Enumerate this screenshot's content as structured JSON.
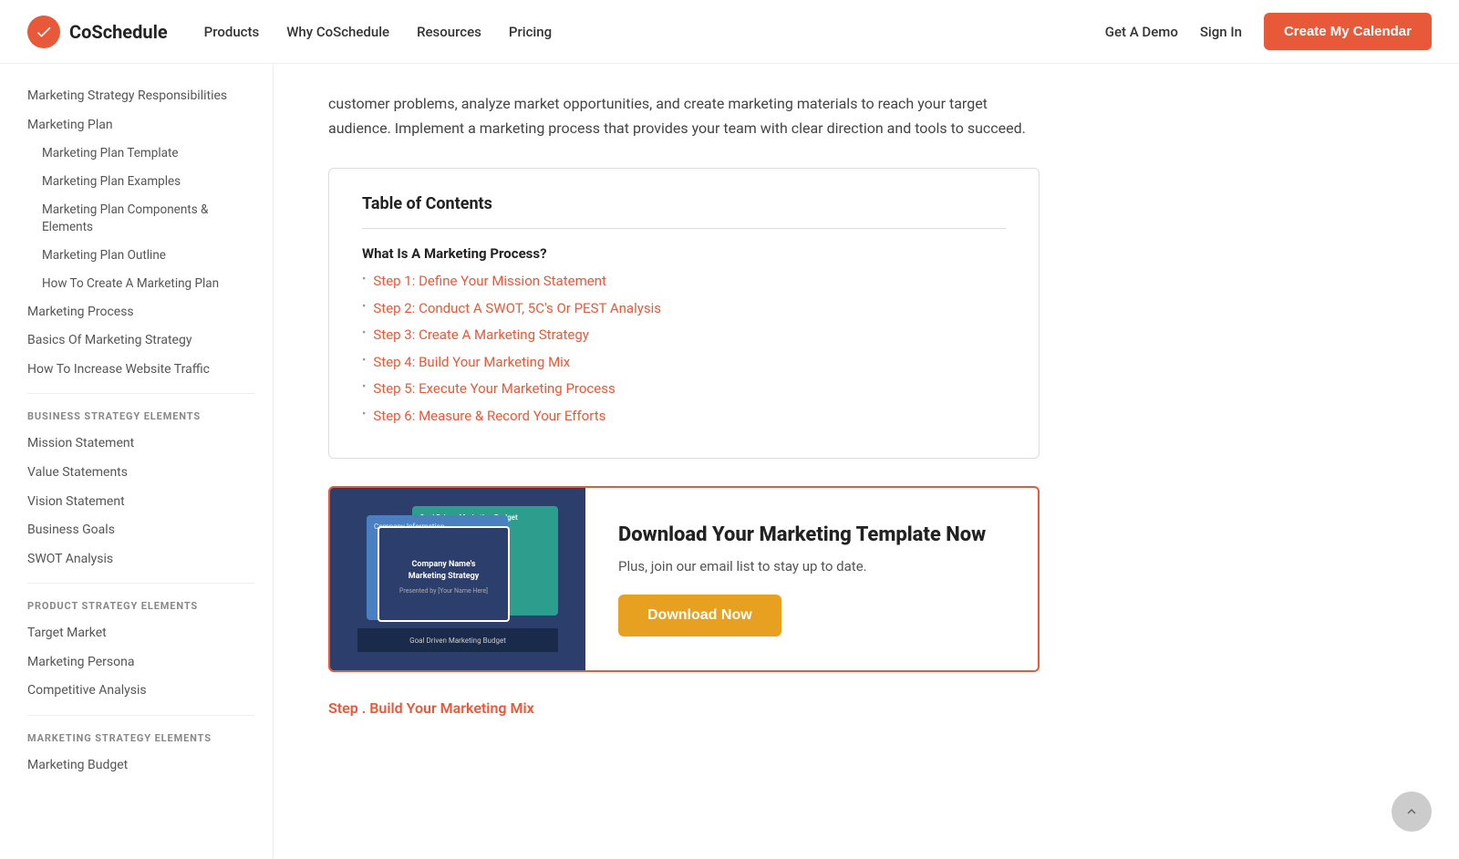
{
  "header": {
    "logo_text": "CoSchedule",
    "nav": [
      {
        "label": "Products",
        "id": "nav-products"
      },
      {
        "label": "Why CoSchedule",
        "id": "nav-why"
      },
      {
        "label": "Resources",
        "id": "nav-resources"
      },
      {
        "label": "Pricing",
        "id": "nav-pricing"
      }
    ],
    "get_demo": "Get A Demo",
    "sign_in": "Sign In",
    "cta_label": "Create My Calendar"
  },
  "sidebar": {
    "top_links": [
      {
        "label": "Marketing Strategy Responsibilities",
        "indent": false
      },
      {
        "label": "Marketing Plan",
        "indent": false
      },
      {
        "label": "Marketing Plan Template",
        "indent": true
      },
      {
        "label": "Marketing Plan Examples",
        "indent": true
      },
      {
        "label": "Marketing Plan Components & Elements",
        "indent": true
      },
      {
        "label": "Marketing Plan Outline",
        "indent": true
      },
      {
        "label": "How To Create A Marketing Plan",
        "indent": true
      },
      {
        "label": "Marketing Process",
        "indent": false
      },
      {
        "label": "Basics Of Marketing Strategy",
        "indent": false
      },
      {
        "label": "How To Increase Website Traffic",
        "indent": false
      }
    ],
    "sections": [
      {
        "title": "BUSINESS STRATEGY ELEMENTS",
        "links": [
          {
            "label": "Mission Statement"
          },
          {
            "label": "Value Statements"
          },
          {
            "label": "Vision Statement"
          },
          {
            "label": "Business Goals"
          },
          {
            "label": "SWOT Analysis"
          }
        ]
      },
      {
        "title": "PRODUCT STRATEGY ELEMENTS",
        "links": [
          {
            "label": "Target Market"
          },
          {
            "label": "Marketing Persona"
          },
          {
            "label": "Competitive Analysis"
          }
        ]
      },
      {
        "title": "MARKETING STRATEGY ELEMENTS",
        "links": [
          {
            "label": "Marketing Budget"
          }
        ]
      }
    ]
  },
  "main": {
    "intro": "customer problems, analyze market opportunities, and create marketing materials to reach your target audience. Implement a marketing process that provides your team with clear direction and tools to succeed.",
    "toc": {
      "title": "Table of Contents",
      "heading": "What Is A Marketing Process?",
      "items": [
        "Step 1: Define Your Mission Statement",
        "Step 2: Conduct A SWOT, 5C's Or PEST Analysis",
        "Step 3: Create A Marketing Strategy",
        "Step 4: Build Your Marketing Mix",
        "Step 5: Execute Your Marketing Process",
        "Step 6: Measure & Record Your Efforts"
      ]
    },
    "cta": {
      "title": "Download Your Marketing Template Now",
      "subtitle": "Plus, join our email list to stay up to date.",
      "button_label": "Download Now",
      "front_card_title": "Company Name's\nMarketing Strategy",
      "front_card_sub": "Presented by [Your Name Here]"
    },
    "step_label": "Step . Build Your Marketing Mix"
  }
}
